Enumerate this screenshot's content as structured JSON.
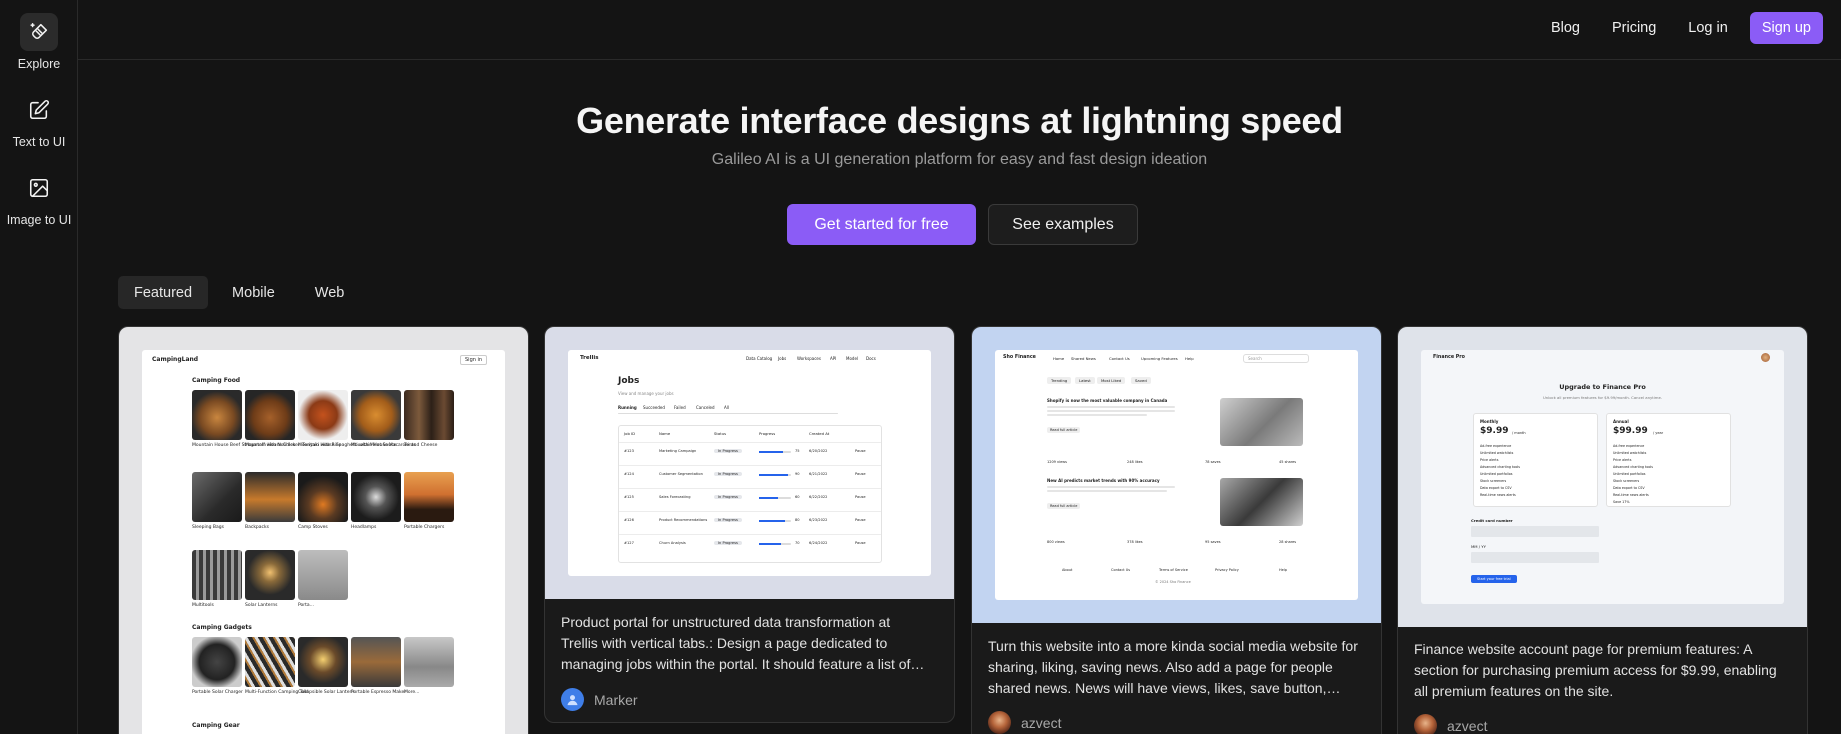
{
  "sidebar": {
    "items": [
      {
        "label": "Explore",
        "icon": "sparkle-brush-icon"
      },
      {
        "label": "Text to UI",
        "icon": "edit-square-icon"
      },
      {
        "label": "Image to UI",
        "icon": "image-icon"
      }
    ]
  },
  "nav": {
    "blog": "Blog",
    "pricing": "Pricing",
    "login": "Log in",
    "signup": "Sign up"
  },
  "hero": {
    "title": "Generate interface designs at lightning speed",
    "subtitle": "Galileo AI is a UI generation platform for easy and fast design ideation",
    "primary_cta": "Get started for free",
    "secondary_cta": "See examples"
  },
  "tabs": [
    "Featured",
    "Mobile",
    "Web"
  ],
  "colors": {
    "accent": "#8b5cf6",
    "background": "#141414"
  },
  "cards": [
    {
      "preview": {
        "brand": "CampingLand",
        "signin": "Sign in",
        "section1": "Camping Food",
        "row1": [
          "Mountain House Beef Stroganoff with Noodles",
          "Mountain House Chicken Teriyaki with Rice",
          "Mountain House Spaghetti with Meat Sauce",
          "Mountain House Macaroni and Cheese",
          "Tents"
        ],
        "row2": [
          "Sleeping Bags",
          "Backpacks",
          "Camp Stoves",
          "Headlamps",
          "Portable Chargers"
        ],
        "row3": [
          "Multitools",
          "Solar Lanterns",
          "Porta..."
        ],
        "section2": "Camping Gadgets",
        "row4": [
          "Portable Solar Charger",
          "Multi-Function Camping Tool",
          "Collapsible Solar Lantern",
          "Portable Espresso Maker",
          "More..."
        ],
        "section3": "Camping Gear"
      }
    },
    {
      "preview": {
        "brand": "Trellis",
        "nav": [
          "Data Catalog",
          "Jobs",
          "Workspaces",
          "API",
          "Model",
          "Docs"
        ],
        "title": "Jobs",
        "subtitle": "View and manage your jobs",
        "tabs": [
          "Running",
          "Succeeded",
          "Failed",
          "Canceled",
          "All"
        ],
        "headers": [
          "Job ID",
          "Name",
          "Status",
          "Progress",
          "Created At"
        ],
        "rows": [
          {
            "id": "#123",
            "name": "Marketing Campaign",
            "status": "In Progress",
            "progress": 75,
            "date": "6/20/2022",
            "action": "Pause"
          },
          {
            "id": "#124",
            "name": "Customer Segmentation",
            "status": "In Progress",
            "progress": 90,
            "date": "6/21/2022",
            "action": "Pause"
          },
          {
            "id": "#125",
            "name": "Sales Forecasting",
            "status": "In Progress",
            "progress": 60,
            "date": "6/22/2022",
            "action": "Pause"
          },
          {
            "id": "#126",
            "name": "Product Recommendations",
            "status": "In Progress",
            "progress": 80,
            "date": "6/23/2022",
            "action": "Pause"
          },
          {
            "id": "#127",
            "name": "Churn Analysis",
            "status": "In Progress",
            "progress": 70,
            "date": "6/24/2022",
            "action": "Pause"
          }
        ]
      },
      "text_lines": [
        "Product portal for unstructured data transformation at",
        "Trellis with vertical tabs.: Design a page dedicated to",
        "managing jobs within the portal. It should feature a list of…"
      ],
      "author": "Marker"
    },
    {
      "preview": {
        "brand": "Sho Finance",
        "nav": [
          "Home",
          "Shared News",
          "Contact Us",
          "Upcoming Features",
          "Help"
        ],
        "search": "Search",
        "chips": [
          "Trending",
          "Latest",
          "Most Liked",
          "Saved"
        ],
        "article1_title": "Shopify is now the most valuable company in Canada",
        "article1_more": "Read full article",
        "article1_stats": [
          "1209 views",
          "248 likes",
          "78 saves",
          "45 shares"
        ],
        "article2_title": "New AI predicts market trends with 90% accuracy",
        "article2_more": "Read full article",
        "article2_stats": [
          "800 views",
          "378 likes",
          "95 saves",
          "28 shares"
        ],
        "footer": [
          "About",
          "Contact Us",
          "Terms of Service",
          "Privacy Policy",
          "Help"
        ],
        "copyright": "© 2024 Sho Finance"
      },
      "text_lines": [
        "Turn this website into a more kinda social media website for",
        "sharing, liking, saving news. Also add a page for people",
        "shared news. News will have views, likes, save button,…"
      ],
      "author": "azvect"
    },
    {
      "preview": {
        "brand": "Finance Pro",
        "title": "Upgrade to Finance Pro",
        "subtitle": "Unlock all premium features for $9.99/month. Cancel anytime.",
        "plan1_name": "Monthly",
        "plan1_price": "$9.99",
        "plan1_unit": "/ month",
        "plan2_name": "Annual",
        "plan2_price": "$99.99",
        "plan2_unit": "/ year",
        "features": [
          "Ad-free experience",
          "Unlimited watchlists",
          "Price alerts",
          "Advanced charting tools",
          "Unlimited portfolios",
          "Stock screeners",
          "Data export to CSV",
          "Real-time news alerts"
        ],
        "features2": [
          "Ad-free experience",
          "Unlimited watchlists",
          "Price alerts",
          "Advanced charting tools",
          "Unlimited portfolios",
          "Stock screeners",
          "Data export to CSV",
          "Real-time news alerts",
          "Save 17%"
        ],
        "field1": "Credit card number",
        "field2": "MM / YY",
        "button": "Start your free trial"
      },
      "text_lines": [
        "Finance website account page for premium features: A",
        "section for purchasing premium access for $9.99, enabling",
        "all premium features on the site."
      ],
      "author": "azvect"
    }
  ]
}
